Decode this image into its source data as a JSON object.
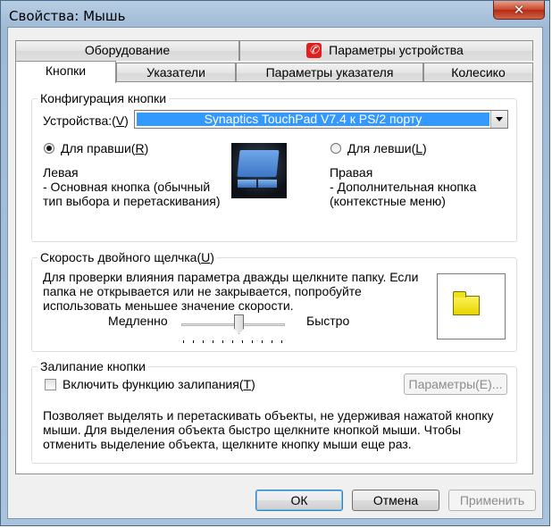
{
  "window": {
    "title": "Свойства: Мышь",
    "close_label": "✕"
  },
  "tabs_top": [
    {
      "label": "Оборудование"
    },
    {
      "label": "Параметры устройства"
    }
  ],
  "tabs_bottom": [
    {
      "label": "Кнопки"
    },
    {
      "label": "Указатели"
    },
    {
      "label": "Параметры указателя"
    },
    {
      "label": "Колесико"
    }
  ],
  "button_config": {
    "group_label": "Конфигурация кнопки",
    "device_label_pre": "Устройства:(",
    "device_label_key": "V",
    "device_label_post": ")",
    "device_value": "Synaptics TouchPad V7.4 к PS/2 порту",
    "right_handed_pre": "Для правши(",
    "right_handed_key": "R",
    "right_handed_post": ")",
    "left_handed_pre": "Для левши(",
    "left_handed_key": "L",
    "left_handed_post": ")",
    "selected": "right",
    "left_title": "Левая",
    "left_desc": " - Основная кнопка (обычный тип выбора и перетаскивания)",
    "right_title": "Правая",
    "right_desc": " - Дополнительная кнопка (контекстные меню)"
  },
  "double_click": {
    "group_label_pre": "Скорость двойного щелчка(",
    "group_label_key": "U",
    "group_label_post": ")",
    "description": "Для проверки влияния параметра дважды щелкните папку. Если папка не открывается или не закрывается, попробуйте использовать меньшее значение скорости.",
    "slow_label": "Медленно",
    "fast_label": "Быстро",
    "speed_level": 0.6
  },
  "click_lock": {
    "group_label": "Залипание кнопки",
    "checkbox_pre": "Включить функцию залипания(",
    "checkbox_key": "T",
    "checkbox_post": ")",
    "checked": false,
    "settings_label": "Параметры(E)...",
    "description": "Позволяет выделять и перетаскивать объекты, не удерживая нажатой кнопку мыши. Для выделения объекта быстро щелкните кнопкой мыши. Чтобы отменить выделение объекта, щелкните кнопку мыши еще раз."
  },
  "footer": {
    "ok_label": "ОК",
    "cancel_label": "Отмена",
    "apply_label": "Применить"
  }
}
